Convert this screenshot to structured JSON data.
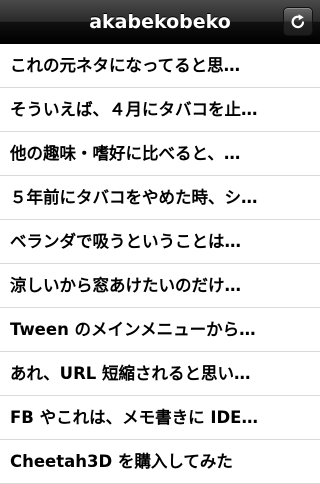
{
  "navbar": {
    "title": "akabekobeko",
    "refresh_icon": "refresh-icon"
  },
  "list": {
    "items": [
      {
        "label": "これの元ネタになってると思…"
      },
      {
        "label": "そういえば、４月にタバコを止…"
      },
      {
        "label": "他の趣味・嗜好に比べると、…"
      },
      {
        "label": "５年前にタバコをやめた時、シ…"
      },
      {
        "label": "ベランダで吸うということは…"
      },
      {
        "label": "涼しいから窓あけたいのだけ…"
      },
      {
        "label": "Tween のメインメニューから…"
      },
      {
        "label": "あれ、URL 短縮されると思い…"
      },
      {
        "label": "FB やこれは、メモ書きに IDE…"
      },
      {
        "label": "Cheetah3D を購入してみた"
      }
    ]
  }
}
